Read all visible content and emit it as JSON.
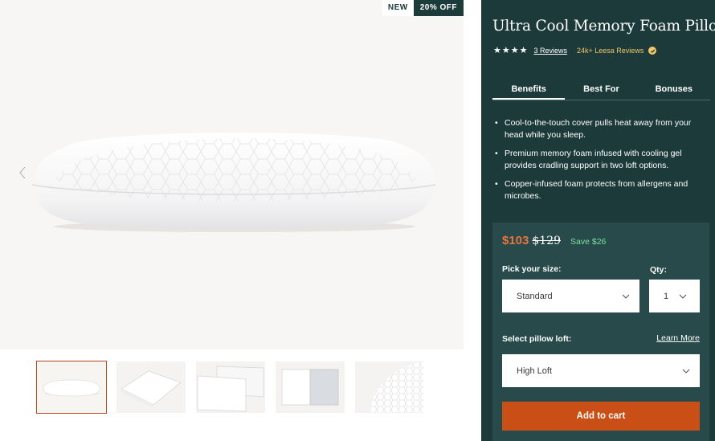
{
  "badges": {
    "new": "NEW",
    "sale": "20% OFF"
  },
  "product": {
    "title": "Ultra Cool Memory Foam Pillow",
    "rating_stars": 4,
    "reviews_link": "3 Reviews",
    "leesa_reviews": "24k+ Leesa Reviews"
  },
  "tabs": [
    {
      "label": "Benefits",
      "active": true
    },
    {
      "label": "Best For",
      "active": false
    },
    {
      "label": "Bonuses",
      "active": false
    }
  ],
  "benefits": [
    "Cool-to-the-touch cover pulls heat away from your head while you sleep.",
    "Premium memory foam infused with cooling gel provides cradling support in two loft options.",
    "Copper-infused foam protects from allergens and microbes."
  ],
  "price": {
    "current": "$103",
    "original": "$129",
    "save": "Save $26"
  },
  "size": {
    "label": "Pick your size:",
    "value": "Standard"
  },
  "qty": {
    "label": "Qty:",
    "value": "1"
  },
  "loft": {
    "label": "Select pillow loft:",
    "learn_more": "Learn More",
    "value": "High Loft"
  },
  "cart": {
    "label": "Add to cart"
  },
  "colors": {
    "panel": "#1c3a3a",
    "buy_box": "#284a4a",
    "accent": "#c94f16",
    "price": "#e8743f",
    "save": "#7ee0a2",
    "leesa": "#f1c66a"
  },
  "icons": [
    "chevron-left-icon",
    "chevron-right-icon",
    "star-icon",
    "verified-check-icon",
    "chevron-down-icon"
  ]
}
